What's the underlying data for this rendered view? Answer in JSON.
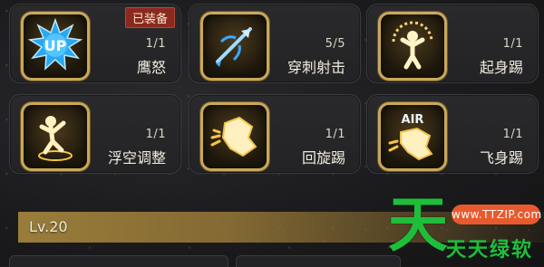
{
  "skills": [
    {
      "name": "鹰怒",
      "count": "1/1",
      "badge": "已装备",
      "icon": "up-burst-icon",
      "icon_text": "UP"
    },
    {
      "name": "穿刺射击",
      "count": "5/5",
      "icon": "arrow-shot-icon"
    },
    {
      "name": "起身踢",
      "count": "1/1",
      "icon": "rising-figure-icon"
    },
    {
      "name": "浮空调整",
      "count": "1/1",
      "icon": "float-adjust-icon"
    },
    {
      "name": "回旋踢",
      "count": "1/1",
      "icon": "spin-kick-icon"
    },
    {
      "name": "飞身踢",
      "count": "1/1",
      "icon": "air-kick-icon",
      "icon_text": "AIR"
    }
  ],
  "level": {
    "label": "Lv.20"
  },
  "watermark": {
    "big": "天",
    "pill": "www.TTZIP.com",
    "text": "天天绿软"
  },
  "colors": {
    "gold": "#c9a85a",
    "badge": "#8a2a1e",
    "watermark_green": "#1fbe3a",
    "watermark_orange": "#e85a2e"
  }
}
